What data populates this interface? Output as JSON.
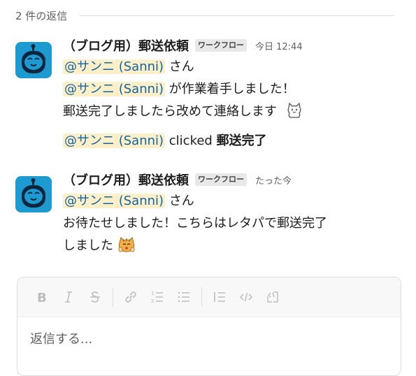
{
  "thread": {
    "reply_count": "2 件の返信"
  },
  "messages": [
    {
      "sender": "（ブログ用）郵送依頼",
      "badge": "ワークフロー",
      "time": "今日 12:44",
      "line1_mention": "@サンニ (Sanni)",
      "line1_text": " さん",
      "line2_mention": "@サンニ (Sanni)",
      "line2_text": " が作業着手しました！",
      "line3_text": "郵送完了しましたら改めて連絡します",
      "line3_emoji": "cat-outline-emoji",
      "action_mention": "@サンニ (Sanni)",
      "action_text": " clicked ",
      "action_bold": "郵送完了"
    },
    {
      "sender": "（ブログ用）郵送依頼",
      "badge": "ワークフロー",
      "time": "たった今",
      "line1_mention": "@サンニ (Sanni)",
      "line1_text": " さん",
      "line2_text": "お待たせしました！こちらはレタパで郵送完了",
      "line3_text": "しました",
      "line3_emoji": "cat-bow-emoji"
    }
  ],
  "composer": {
    "placeholder": "返信する...",
    "toolbar_icons": [
      "bold-icon",
      "italic-icon",
      "strikethrough-icon",
      "link-icon",
      "ordered-list-icon",
      "bulleted-list-icon",
      "blockquote-icon",
      "code-icon",
      "code-block-icon"
    ]
  },
  "colors": {
    "mention": "#1264a3",
    "mention_bg": "#fdf0c8",
    "avatar": "#1d9bd1"
  }
}
